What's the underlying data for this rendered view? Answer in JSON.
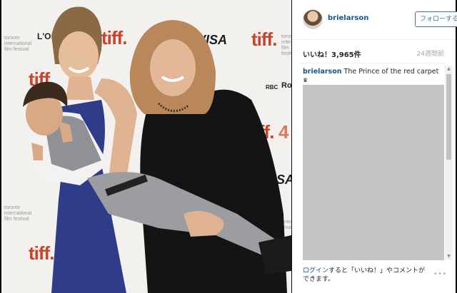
{
  "post": {
    "username": "brielarson",
    "follow_label": "フォローする",
    "likes": "いいね！3,965件",
    "age": "24週間前",
    "caption_user": "brielarson",
    "caption_text": "The Prince of the red carpet",
    "caption_emoji": "♛",
    "login_link": "ログイン",
    "login_text": "すると「いいね！」やコメントができます。",
    "more_icon": "•••"
  },
  "backdrop": {
    "tiff_logo": "tiff.",
    "visa_logo": "VISA",
    "loreal": "L'O",
    "festival": "toronto international film festival",
    "rbc": "RBC",
    "roy": "Roy",
    "digit": "4"
  },
  "colors": {
    "accent": "#125688",
    "follow_border": "#3f729b",
    "tiff_red": "#c8452d"
  }
}
